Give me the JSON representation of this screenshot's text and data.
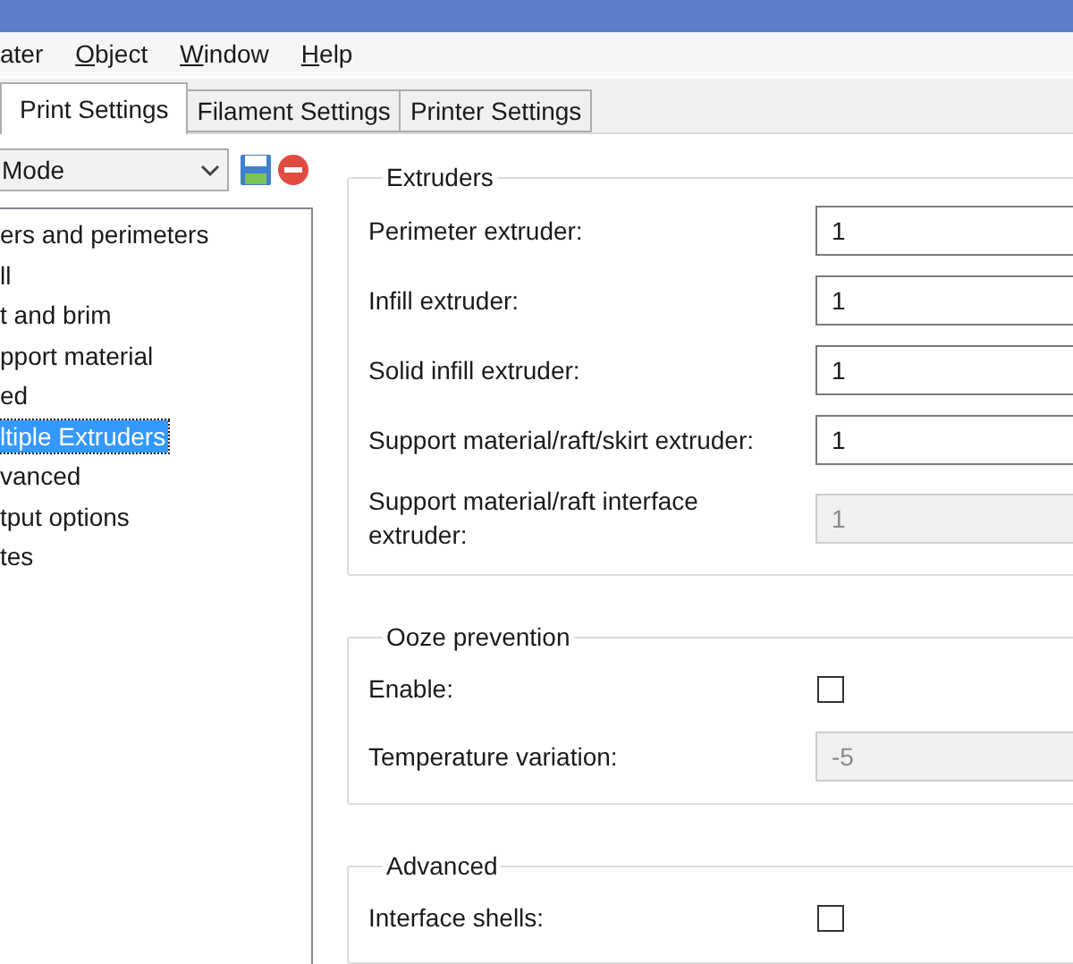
{
  "menu": [
    {
      "label": "ater",
      "mnemonic": false
    },
    {
      "label": "Object",
      "mnemonic": true
    },
    {
      "label": "Window",
      "mnemonic": true
    },
    {
      "label": "Help",
      "mnemonic": true
    }
  ],
  "tabs": [
    {
      "label": "Print Settings",
      "selected": true
    },
    {
      "label": "Filament Settings",
      "selected": false
    },
    {
      "label": "Printer Settings",
      "selected": false
    }
  ],
  "preset": {
    "value": "Mode"
  },
  "pages": [
    {
      "label": "ers and perimeters",
      "selected": false
    },
    {
      "label": "ll",
      "selected": false
    },
    {
      "label": "t and brim",
      "selected": false
    },
    {
      "label": "pport material",
      "selected": false
    },
    {
      "label": "ed",
      "selected": false
    },
    {
      "label": "ltiple Extruders",
      "selected": true
    },
    {
      "label": "vanced",
      "selected": false
    },
    {
      "label": "tput options",
      "selected": false
    },
    {
      "label": "tes",
      "selected": false
    }
  ],
  "groups": [
    {
      "title": "Extruders",
      "options": [
        {
          "label": "Perimeter extruder:",
          "kind": "text",
          "value": "1",
          "disabled": false
        },
        {
          "label": "Infill extruder:",
          "kind": "text",
          "value": "1",
          "disabled": false
        },
        {
          "label": "Solid infill extruder:",
          "kind": "text",
          "value": "1",
          "disabled": false
        },
        {
          "label": "Support material/raft/skirt extruder:",
          "kind": "text",
          "value": "1",
          "disabled": false
        },
        {
          "label": "Support material/raft interface extruder:",
          "kind": "text",
          "value": "1",
          "disabled": true
        }
      ]
    },
    {
      "title": "Ooze prevention",
      "options": [
        {
          "label": "Enable:",
          "kind": "checkbox",
          "checked": false
        },
        {
          "label": "Temperature variation:",
          "kind": "text",
          "value": "-5",
          "disabled": true
        }
      ]
    },
    {
      "title": "Advanced",
      "options": [
        {
          "label": "Interface shells:",
          "kind": "checkbox",
          "checked": false
        }
      ]
    }
  ]
}
